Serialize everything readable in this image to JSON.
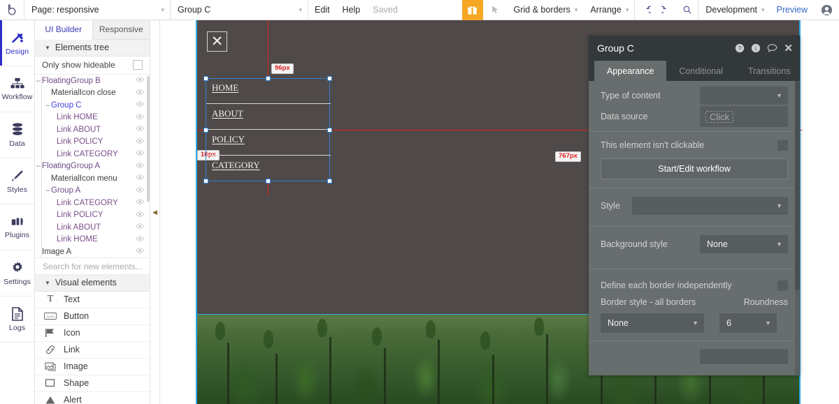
{
  "topbar": {
    "logo": "bubble-logo",
    "page_select": {
      "label": "Page: responsive",
      "caret": "▾"
    },
    "group_select": {
      "label": "Group C",
      "caret": "▾"
    },
    "edit": "Edit",
    "help": "Help",
    "saved": "Saved",
    "gift": "gift-icon",
    "cursor": "cursor-icon",
    "grid_borders": {
      "label": "Grid & borders",
      "caret": "▾"
    },
    "arrange": {
      "label": "Arrange",
      "caret": "▾"
    },
    "undo": "undo-icon",
    "redo": "redo-icon",
    "search": "search-icon",
    "version": {
      "label": "Development",
      "caret": "▾"
    },
    "preview": "Preview",
    "avatar": "user-avatar-icon",
    "accent_gift": "#f6a724",
    "accent_preview": "#3668c7"
  },
  "rail": {
    "items": [
      {
        "label": "Design",
        "icon": "design-tools-icon",
        "active": true
      },
      {
        "label": "Workflow",
        "icon": "workflow-icon",
        "active": false
      },
      {
        "label": "Data",
        "icon": "database-icon",
        "active": false
      },
      {
        "label": "Styles",
        "icon": "brush-icon",
        "active": false
      },
      {
        "label": "Plugins",
        "icon": "plugins-icon",
        "active": false
      },
      {
        "label": "Settings",
        "icon": "gear-icon",
        "active": false
      },
      {
        "label": "Logs",
        "icon": "logs-icon",
        "active": false
      }
    ],
    "active_color": "#2c2cc9"
  },
  "elements_panel": {
    "tabs": [
      {
        "label": "UI Builder",
        "active": true
      },
      {
        "label": "Responsive",
        "active": false
      }
    ],
    "elements_tree_header": "Elements tree",
    "only_show_hideable": "Only show hideable",
    "tree": [
      {
        "label": "FloatingGroup B",
        "level": 0,
        "kind": "group",
        "dash": "–",
        "selected": false
      },
      {
        "label": "MaterialIcon close",
        "level": 1,
        "kind": "plain",
        "dash": "",
        "selected": false
      },
      {
        "label": "Group C",
        "level": 1,
        "kind": "group",
        "dash": "–",
        "selected": true
      },
      {
        "label": "Link HOME",
        "level": 2,
        "kind": "link",
        "dash": "",
        "selected": false
      },
      {
        "label": "Link ABOUT",
        "level": 2,
        "kind": "link",
        "dash": "",
        "selected": false
      },
      {
        "label": "Link POLICY",
        "level": 2,
        "kind": "link",
        "dash": "",
        "selected": false
      },
      {
        "label": "Link CATEGORY",
        "level": 2,
        "kind": "link",
        "dash": "",
        "selected": false
      },
      {
        "label": "FloatingGroup A",
        "level": 0,
        "kind": "group",
        "dash": "–",
        "selected": false
      },
      {
        "label": "MaterialIcon menu",
        "level": 1,
        "kind": "plain",
        "dash": "",
        "selected": false
      },
      {
        "label": "Group A",
        "level": 1,
        "kind": "group",
        "dash": "–",
        "selected": false
      },
      {
        "label": "Link CATEGORY",
        "level": 2,
        "kind": "link",
        "dash": "",
        "selected": false
      },
      {
        "label": "Link POLICY",
        "level": 2,
        "kind": "link",
        "dash": "",
        "selected": false
      },
      {
        "label": "Link ABOUT",
        "level": 2,
        "kind": "link",
        "dash": "",
        "selected": false
      },
      {
        "label": "Link HOME",
        "level": 2,
        "kind": "link",
        "dash": "",
        "selected": false
      },
      {
        "label": "Image A",
        "level": 0,
        "kind": "plain",
        "dash": "",
        "selected": false
      }
    ],
    "search_placeholder": "Search for new elements...",
    "visual_elements_header": "Visual elements",
    "visual_elements": [
      {
        "label": "Text",
        "icon": "text-icon"
      },
      {
        "label": "Button",
        "icon": "button-icon"
      },
      {
        "label": "Icon",
        "icon": "flag-icon"
      },
      {
        "label": "Link",
        "icon": "link-icon"
      },
      {
        "label": "Image",
        "icon": "image-icon"
      },
      {
        "label": "Shape",
        "icon": "shape-icon"
      },
      {
        "label": "Alert",
        "icon": "alert-icon"
      }
    ]
  },
  "canvas": {
    "close_icon": "✕",
    "menu_items": [
      "HOME",
      "ABOUT",
      "POLICY",
      "CATEGORY"
    ],
    "guides": [
      {
        "name": "top-distance",
        "value": "96px"
      },
      {
        "name": "left-distance",
        "value": "16px"
      },
      {
        "name": "right-distance",
        "value": "767px"
      }
    ],
    "page_bg": "#4f4a49",
    "selection_color": "#2f7fd0",
    "guide_color": "#e02020"
  },
  "property_panel": {
    "title": "Group C",
    "head_icons": [
      "help-circle-icon",
      "info-circle-icon",
      "comment-icon",
      "close-icon"
    ],
    "tabs": [
      {
        "label": "Appearance",
        "active": true
      },
      {
        "label": "Conditional",
        "active": false
      },
      {
        "label": "Transitions",
        "active": false
      }
    ],
    "fields": {
      "type_of_content_label": "Type of content",
      "type_of_content_value": "",
      "data_source_label": "Data source",
      "data_source_placeholder": "Click",
      "not_clickable_label": "This element isn't clickable",
      "workflow_button": "Start/Edit workflow",
      "style_label": "Style",
      "style_value": "",
      "background_style_label": "Background style",
      "background_style_value": "None",
      "define_borders_label": "Define each border independently",
      "border_style_label": "Border style - all borders",
      "border_style_value": "None",
      "roundness_label": "Roundness",
      "roundness_value": "6"
    }
  }
}
